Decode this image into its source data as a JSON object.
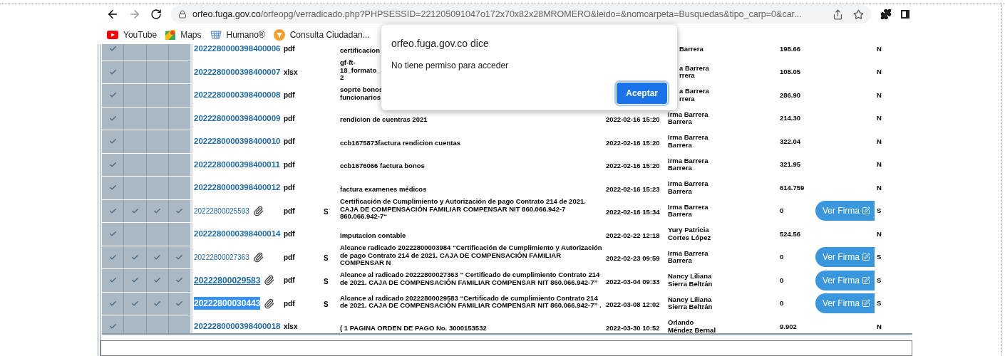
{
  "browser": {
    "url_host": "orfeo.fuga.gov.co",
    "url_path": "/orfeopg/verradicado.php?PHPSESSID=221205091047o172x70x82x28MROMERO&leido=&nomcarpeta=Busquedas&tipo_carp=0&car...",
    "bookmarks": [
      {
        "label": "YouTube",
        "kind": "play"
      },
      {
        "label": "Maps",
        "kind": "map"
      },
      {
        "label": "Humano®",
        "kind": "grid"
      },
      {
        "label": "Consulta Ciudadan...",
        "kind": "funnel"
      }
    ]
  },
  "dialog": {
    "title": "orfeo.fuga.gov.co dice",
    "message": "No tiene permiso para acceder",
    "button": "Aceptar"
  },
  "rows": [
    {
      "checks": [
        true,
        false,
        false,
        false
      ],
      "id": "2022280000398400006",
      "kind": "bold",
      "attachment": false,
      "type": "pdf",
      "description": "certificacion",
      "name": "Barrera",
      "value": "198.66",
      "flag": "N"
    },
    {
      "checks": [
        true,
        false,
        false,
        false
      ],
      "id": "2022280000398400007",
      "kind": "bold",
      "attachment": false,
      "type": "xlsx",
      "description": "gf-ft-\n18_formato_\n2",
      "name": "a Barrera\nrrera",
      "value": "108.05",
      "flag": "N"
    },
    {
      "checks": [
        true,
        false,
        false,
        false
      ],
      "id": "2022280000398400008",
      "kind": "bold",
      "attachment": false,
      "type": "pdf",
      "description": "soprte bonos\nfuncionarios",
      "name": "a Barrera\nrrera",
      "value": "286.90",
      "flag": "N"
    },
    {
      "checks": [
        true,
        false,
        false,
        false
      ],
      "id": "2022280000398400009",
      "kind": "bold",
      "attachment": false,
      "type": "pdf",
      "description": "rendicion de cuentras 2021",
      "date": "2022-02-16 15:20",
      "name": "Irma Barrera Barrera",
      "value": "214.30",
      "flag": "N"
    },
    {
      "checks": [
        true,
        false,
        false,
        false
      ],
      "id": "2022280000398400010",
      "kind": "bold",
      "attachment": false,
      "type": "pdf",
      "description": "ccb1675873factura rendicion cuentas",
      "date": "2022-02-16 15:20",
      "name": "Irma Barrera Barrera",
      "value": "322.04",
      "flag": "N"
    },
    {
      "checks": [
        true,
        false,
        false,
        false
      ],
      "id": "2022280000398400011",
      "kind": "bold",
      "attachment": false,
      "type": "pdf",
      "description": "ccb1676066 factura bonos",
      "date": "2022-02-16 15:20",
      "name": "Irma Barrera Barrera",
      "value": "321.95",
      "flag": "N"
    },
    {
      "checks": [
        true,
        false,
        false,
        false
      ],
      "id": "2022280000398400012",
      "kind": "bold",
      "attachment": false,
      "type": "pdf",
      "description": "factura examenes médicos",
      "date": "2022-02-16 15:23",
      "name": "Irma Barrera Barrera",
      "value": "614.759",
      "flag": "N"
    },
    {
      "checks": [
        true,
        true,
        true,
        true
      ],
      "id": "20222800025593",
      "kind": "small",
      "attachment": true,
      "type": "pdf",
      "signed": "S",
      "description": "Certificación de Cumplimiento y Autorización de pago Contrato 214 de 2021. CAJA DE COMPENSACIÓN FAMILIAR COMPENSAR NIT 860.066.942-7 860.066.942-7“",
      "date": "2022-02-16 15:34",
      "name": "Irma Barrera Barrera",
      "value": "0",
      "firma": "Ver Firma",
      "flag": "S"
    },
    {
      "checks": [
        true,
        false,
        false,
        false
      ],
      "id": "2022280000398400014",
      "kind": "bold",
      "attachment": false,
      "type": "pdf",
      "description": "imputacion contable",
      "date": "2022-02-22 12:18",
      "name": "Yury Patricia Cortes López",
      "value": "524.56",
      "flag": "N"
    },
    {
      "checks": [
        true,
        true,
        true,
        true
      ],
      "id": "20222800027363",
      "kind": "small",
      "attachment": true,
      "type": "pdf",
      "signed": "S",
      "description": "Alcance radicado 20222800003984 “Certificación de Cumplimiento y Autorización de pago Contrato 214 de 2021. CAJA DE COMPENSACIÓN FAMILIAR COMPENSAR N",
      "date": "2022-02-23 09:59",
      "name": "Irma Barrera Barrera",
      "value": "0",
      "firma": "Ver Firma",
      "flag": "S"
    },
    {
      "checks": [
        true,
        true,
        true,
        true
      ],
      "id": "20222800029583",
      "kind": "underlined",
      "attachment": true,
      "type": "pdf",
      "signed": "S",
      "description": "Alcance al radicado 20222800027363 “ Certificado de cumplimiento Contrato 214 de 2021. CAJA DE COMPENSACIÓN FAMILIAR COMPENSAR NIT 860.066.942-7”",
      "date": "2022-03-04 09:33",
      "name": "Nancy Liliana Sierra Beltrán",
      "value": "0",
      "firma": "Ver Firma",
      "flag": "S"
    },
    {
      "checks": [
        true,
        true,
        true,
        true
      ],
      "id": "20222800030443",
      "kind": "highlighted",
      "attachment": true,
      "type": "pdf",
      "signed": "S",
      "description": "Alcance al radicado 20222800029583 “Certificado de cumplimiento Contrato 214 de 2021. CAJA DE COMPENSACIÓN FAMILIAR COMPENSAR NIT 860.066.942-7” .",
      "date": "2022-03-08 12:02",
      "name": "Nancy Liliana Sierra Beltrán",
      "value": "0",
      "firma": "Ver Firma",
      "flag": "S"
    },
    {
      "checks": [
        true,
        false,
        false,
        false
      ],
      "id": "2022280000398400018",
      "kind": "bold",
      "attachment": false,
      "type": "xlsx",
      "description": "( 1 PAGINA ORDEN DE PAGO No. 3000153532",
      "date": "2022-03-30 10:52",
      "name": "Orlando Méndez Bernal",
      "value": "9.902",
      "flag": "N"
    }
  ]
}
